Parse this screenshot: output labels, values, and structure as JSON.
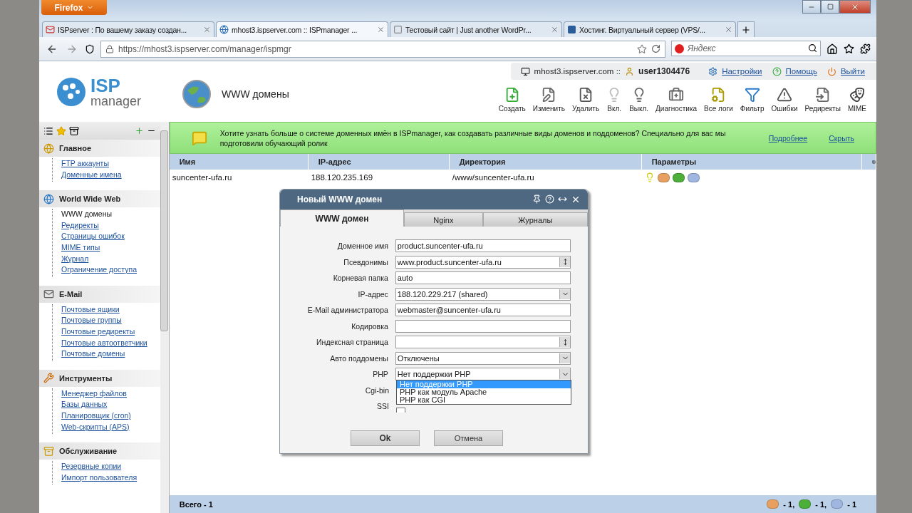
{
  "browser": {
    "menu_button": "Firefox",
    "tabs": [
      {
        "label": "ISPserver : По вашему заказу создан...",
        "kind": "mail",
        "selected": false
      },
      {
        "label": "mhost3.ispserver.com :: ISPmanager ...",
        "kind": "isp",
        "selected": true
      },
      {
        "label": "Тестовый сайт | Just another WordPr...",
        "kind": "blank",
        "selected": false
      },
      {
        "label": "Хостинг. Виртуальный сервер (VPS/...",
        "kind": "square",
        "selected": false
      }
    ],
    "url": "https://mhost3.ispserver.com/manager/ispmgr",
    "search_placeholder": "Яндекс"
  },
  "header": {
    "logo_top": "ISP",
    "logo_bottom": "manager",
    "page_title": "WWW домены",
    "server": "mhost3.ispserver.com ::",
    "user": "user1304476",
    "links": [
      {
        "label": "Настройки",
        "kind": "settings"
      },
      {
        "label": "Помощь",
        "kind": "help"
      },
      {
        "label": "Выйти",
        "kind": "exit"
      }
    ],
    "toolbar": [
      {
        "label": "Создать",
        "kind": "create"
      },
      {
        "label": "Изменить",
        "kind": "edit"
      },
      {
        "label": "Удалить",
        "kind": "delete"
      },
      {
        "label": "Вкл.",
        "kind": "on"
      },
      {
        "label": "Выкл.",
        "kind": "off"
      },
      {
        "label": "Диагностика",
        "kind": "diag"
      },
      {
        "label": "Все логи",
        "kind": "logs"
      },
      {
        "label": "Фильтр",
        "kind": "filter"
      },
      {
        "label": "Ошибки",
        "kind": "errors"
      },
      {
        "label": "Редиректы",
        "kind": "redirects"
      },
      {
        "label": "MIME",
        "kind": "mime"
      }
    ]
  },
  "banner": {
    "text": "Хотите узнать больше о системе доменных имён в ISPmanager, как создавать различные виды доменов и поддоменов? Специально для вас мы подготовили обучающий ролик",
    "links": [
      "Подробнее",
      "Скрыть"
    ]
  },
  "sidebar": {
    "groups": [
      {
        "title": "Главное",
        "kind": "main",
        "items": [
          {
            "label": "FTP аккаунты",
            "selected": false
          },
          {
            "label": "Доменные имена",
            "selected": false
          }
        ]
      },
      {
        "title": "World Wide Web",
        "kind": "web",
        "items": [
          {
            "label": "WWW домены",
            "selected": true
          },
          {
            "label": "Редиректы",
            "selected": false
          },
          {
            "label": "Страницы ошибок",
            "selected": false
          },
          {
            "label": "MIME типы",
            "selected": false
          },
          {
            "label": "Журнал",
            "selected": false
          },
          {
            "label": "Ограничение доступа",
            "selected": false
          }
        ]
      },
      {
        "title": "E-Mail",
        "kind": "mail",
        "items": [
          {
            "label": "Почтовые ящики",
            "selected": false
          },
          {
            "label": "Почтовые группы",
            "selected": false
          },
          {
            "label": "Почтовые редиректы",
            "selected": false
          },
          {
            "label": "Почтовые автоответчики",
            "selected": false
          },
          {
            "label": "Почтовые домены",
            "selected": false
          }
        ]
      },
      {
        "title": "Инструменты",
        "kind": "tools",
        "items": [
          {
            "label": "Менеджер файлов",
            "selected": false
          },
          {
            "label": "Базы данных",
            "selected": false
          },
          {
            "label": "Планировщик (cron)",
            "selected": false
          },
          {
            "label": "Web-скрипты (APS)",
            "selected": false
          }
        ]
      },
      {
        "title": "Обслуживание",
        "kind": "service",
        "items": [
          {
            "label": "Резервные копии",
            "selected": false
          },
          {
            "label": "Импорт пользователя",
            "selected": false
          }
        ]
      }
    ]
  },
  "table": {
    "columns": [
      "Имя",
      "IP-адрес",
      "Директория",
      "Параметры"
    ],
    "rows": [
      {
        "cells": [
          "suncenter-ufa.ru",
          "188.120.235.169",
          "/www/suncenter-ufa.ru"
        ],
        "params": [
          {
            "kind": "bulb"
          },
          {
            "kind": "cgi"
          },
          {
            "kind": "php"
          },
          {
            "kind": "ssi"
          }
        ]
      }
    ],
    "footer": "Всего - 1",
    "footer_counts": [
      {
        "kind": "cgi",
        "count": "- 1,"
      },
      {
        "kind": "php",
        "count": "- 1,"
      },
      {
        "kind": "ssi",
        "count": "- 1"
      }
    ]
  },
  "dialog": {
    "title": "Новый WWW домен",
    "tabs": [
      {
        "label": "WWW домен",
        "selected": true
      },
      {
        "label": "Nginx",
        "selected": false
      },
      {
        "label": "Журналы",
        "selected": false
      }
    ],
    "fields": [
      {
        "label": "Доменное имя",
        "kind": "text",
        "value": "product.suncenter-ufa.ru"
      },
      {
        "label": "Псевдонимы",
        "kind": "spin",
        "value": "www.product.suncenter-ufa.ru"
      },
      {
        "label": "Корневая папка",
        "kind": "text",
        "value": "auto"
      },
      {
        "label": "IP-адрес",
        "kind": "select",
        "value": "188.120.229.217 (shared)"
      },
      {
        "label": "E-Mail администратора",
        "kind": "text",
        "value": "webmaster@suncenter-ufa.ru"
      },
      {
        "label": "Кодировка",
        "kind": "text"
      },
      {
        "label": "Индексная страница",
        "kind": "spin"
      },
      {
        "label": "Авто поддомены",
        "kind": "select",
        "value": "Отключены"
      },
      {
        "label": "PHP",
        "kind": "select",
        "value": "Нет поддержки PHP",
        "open": true,
        "options": [
          {
            "label": "Нет поддержки PHP",
            "selected": true
          },
          {
            "label": "PHP как модуль Apache",
            "selected": false
          },
          {
            "label": "PHP как CGI",
            "selected": false
          }
        ]
      },
      {
        "label": "Cgi-bin",
        "kind": "covered"
      },
      {
        "label": "SSI",
        "kind": "checkbox",
        "checked": false
      }
    ],
    "buttons": [
      "Ok",
      "Отмена"
    ]
  }
}
